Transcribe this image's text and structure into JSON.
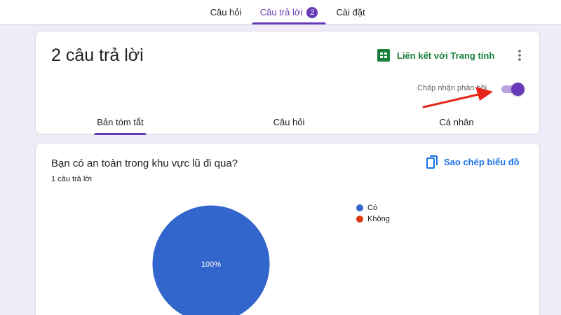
{
  "top_tabs": {
    "questions": "Câu hỏi",
    "responses": "Câu trả lời",
    "responses_count": "2",
    "settings": "Cài đặt"
  },
  "summary_card": {
    "title": "2 câu trả lời",
    "link_sheets_label": "Liên kết với Trang tính",
    "more_icon": "more-vert-icon",
    "accepting_label": "Chấp nhận phản hồi",
    "accepting_enabled": true,
    "view_tabs": [
      "Bản tóm tắt",
      "Câu hỏi",
      "Cá nhân"
    ],
    "active_view_tab": "Bản tóm tắt"
  },
  "question_card": {
    "question": "Bạn có an toàn trong khu vực lũ đi qua?",
    "response_count": "1 câu trả lời",
    "copy_chart_label": "Sao chép biểu đồ",
    "copy_icon": "copy-icon"
  },
  "chart_data": {
    "type": "pie",
    "categories": [
      "Có",
      "Không"
    ],
    "values": [
      100,
      0
    ],
    "colors": [
      "#3366cc",
      "#dc3912"
    ],
    "slice_label": "100%",
    "legend_position": "right"
  },
  "colors": {
    "accent": "#673ab7",
    "sheets_green": "#188038",
    "link_blue": "#1a73e8",
    "background": "#efebf8",
    "annotation_arrow": "#e8251b"
  }
}
